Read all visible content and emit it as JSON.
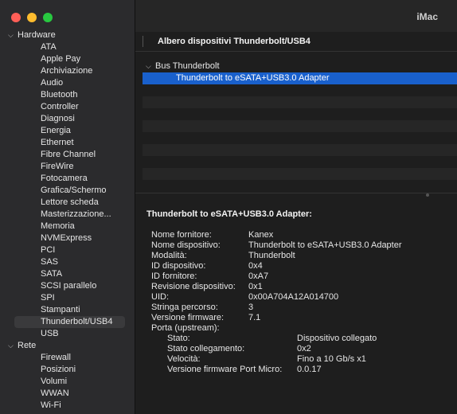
{
  "window": {
    "title": "iMac"
  },
  "sidebar": {
    "hardware_label": "Hardware",
    "hardware_items": [
      "ATA",
      "Apple Pay",
      "Archiviazione",
      "Audio",
      "Bluetooth",
      "Controller",
      "Diagnosi",
      "Energia",
      "Ethernet",
      "Fibre Channel",
      "FireWire",
      "Fotocamera",
      "Grafica/Schermo",
      "Lettore scheda",
      "Masterizzazione...",
      "Memoria",
      "NVMExpress",
      "PCI",
      "SAS",
      "SATA",
      "SCSI parallelo",
      "SPI",
      "Stampanti",
      "Thunderbolt/USB4",
      "USB"
    ],
    "selected_item": "Thunderbolt/USB4",
    "rete_label": "Rete",
    "rete_items": [
      "Firewall",
      "Posizioni",
      "Volumi",
      "WWAN",
      "Wi-Fi"
    ]
  },
  "main": {
    "header": "Albero dispositivi Thunderbolt/USB4",
    "bus_label": "Bus Thunderbolt",
    "device_label": "Thunderbolt to eSATA+USB3.0 Adapter"
  },
  "details": {
    "title": "Thunderbolt to eSATA+USB3.0 Adapter:",
    "props": [
      {
        "k": "Nome fornitore:",
        "v": "Kanex"
      },
      {
        "k": "Nome dispositivo:",
        "v": "Thunderbolt to eSATA+USB3.0 Adapter"
      },
      {
        "k": "Modalità:",
        "v": "Thunderbolt"
      },
      {
        "k": "ID dispositivo:",
        "v": "0x4"
      },
      {
        "k": "ID fornitore:",
        "v": "0xA7"
      },
      {
        "k": "Revisione dispositivo:",
        "v": "0x1"
      },
      {
        "k": "UID:",
        "v": "0x00A704A12A014700"
      },
      {
        "k": "Stringa percorso:",
        "v": "3"
      },
      {
        "k": "Versione firmware:",
        "v": "7.1"
      },
      {
        "k": "Porta (upstream):",
        "v": ""
      }
    ],
    "port_props": [
      {
        "k": "Stato:",
        "v": "Dispositivo collegato"
      },
      {
        "k": "Stato collegamento:",
        "v": "0x2"
      },
      {
        "k": "Velocità:",
        "v": "Fino a 10 Gb/s x1"
      },
      {
        "k": "Versione firmware Port Micro:",
        "v": "0.0.17"
      }
    ]
  }
}
